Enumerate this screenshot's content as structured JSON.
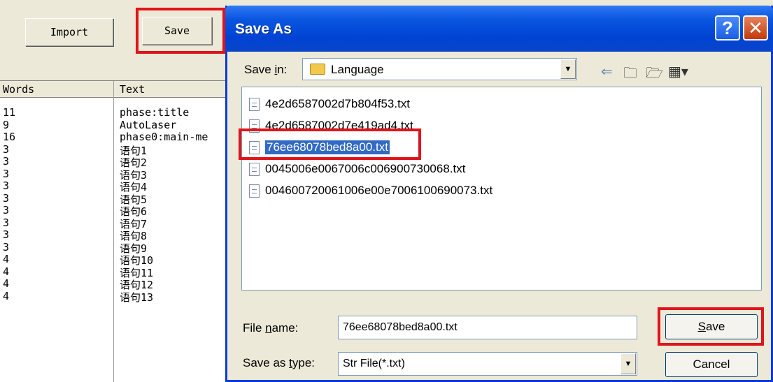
{
  "app": {
    "import_label": "Import",
    "save_label": "Save",
    "columns": [
      "Words",
      "Text"
    ],
    "rows": [
      {
        "words": "11",
        "text": "phase:title"
      },
      {
        "words": "9",
        "text": "AutoLaser"
      },
      {
        "words": "16",
        "text": "phase0:main-me"
      },
      {
        "words": "3",
        "text": "语句1"
      },
      {
        "words": "3",
        "text": "语句2"
      },
      {
        "words": "3",
        "text": "语句3"
      },
      {
        "words": "3",
        "text": "语句4"
      },
      {
        "words": "3",
        "text": "语句5"
      },
      {
        "words": "3",
        "text": "语句6"
      },
      {
        "words": "3",
        "text": "语句7"
      },
      {
        "words": "3",
        "text": "语句8"
      },
      {
        "words": "3",
        "text": "语句9"
      },
      {
        "words": "4",
        "text": "语句10"
      },
      {
        "words": "4",
        "text": "语句11"
      },
      {
        "words": "4",
        "text": "语句12"
      },
      {
        "words": "4",
        "text": "语句13"
      }
    ]
  },
  "dialog": {
    "title": "Save As",
    "help_glyph": "?",
    "close_glyph": "✕",
    "save_in_label_pre": "Save ",
    "save_in_label_key": "i",
    "save_in_label_post": "n:",
    "save_in_value": "Language",
    "toolbar_icons": [
      "back-arrow-icon",
      "up-folder-icon",
      "new-folder-icon",
      "view-menu-icon"
    ],
    "files": [
      "4e2d6587002d7b804f53.txt",
      "4e2d6587002d7e419ad4.txt",
      "76ee68078bed8a00.txt",
      "0045006e0067006c006900730068.txt",
      "004600720061006e00e7006100690073.txt"
    ],
    "selected_file_index": 2,
    "file_name_label_pre": "File ",
    "file_name_label_key": "n",
    "file_name_label_post": "ame:",
    "file_name_value": "76ee68078bed8a00.txt",
    "save_as_type_label_pre": "Save as ",
    "save_as_type_label_key": "t",
    "save_as_type_label_post": "ype:",
    "save_as_type_value": "Str File(*.txt)",
    "save_button_key": "S",
    "save_button_rest": "ave",
    "cancel_label": "Cancel"
  },
  "colors": {
    "highlight": "#e0141c",
    "selection": "#316ac5",
    "titlebar": "#0043d4"
  }
}
